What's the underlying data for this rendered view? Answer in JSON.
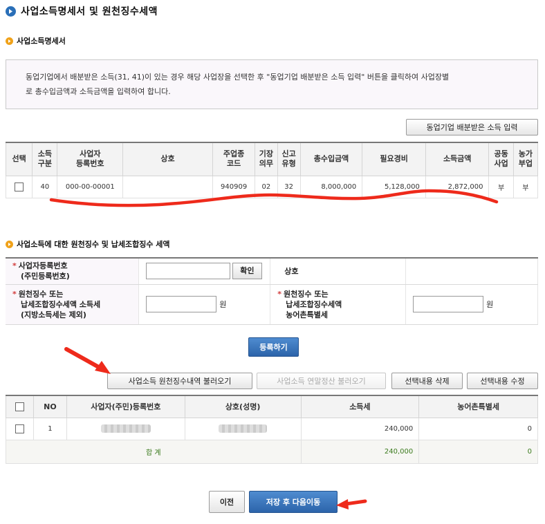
{
  "page": {
    "title": "사업소득명세서 및 원천징수세액"
  },
  "section1": {
    "title": "사업소득명세서",
    "notice_line1": "동업기업에서 배분받은 소득(31, 41)이 있는 경우 해당 사업장을 선택한 후 \"동업기업 배분받은 소득 입력\" 버튼을 클릭하여 사업장별",
    "notice_line2": "로 총수입금액과 소득금액을 입력하여 합니다.",
    "input_button": "동업기업 배분받은 소득 입력",
    "headers": {
      "select": "선택",
      "income_type_1": "소득",
      "income_type_2": "구분",
      "bizno_1": "사업자",
      "bizno_2": "등록번호",
      "name": "상호",
      "industry_1": "주업종",
      "industry_2": "코드",
      "bookkeep_1": "기장",
      "bookkeep_2": "의무",
      "report_1": "신고",
      "report_2": "유형",
      "revenue": "총수입금액",
      "expense": "필요경비",
      "income": "소득금액",
      "joint_1": "공동",
      "joint_2": "사업",
      "farm_1": "농가",
      "farm_2": "부업"
    },
    "row": {
      "income_type": "40",
      "bizno": "000-00-00001",
      "name": "",
      "industry": "940909",
      "bookkeep": "02",
      "report": "32",
      "revenue": "8,000,000",
      "expense": "5,128,000",
      "income": "2,872,000",
      "joint": "부",
      "farm": "부"
    }
  },
  "section2": {
    "title": "사업소득에 대한 원천징수 및 납세조합징수 세액",
    "bizno_label_1": "사업자등록번호",
    "bizno_label_2": "(주민등록번호)",
    "confirm_button": "확인",
    "name_label": "상호",
    "tax_label_1": "원천징수 또는",
    "tax_label_2": "납세조합징수세액 소득세",
    "tax_label_3": "(지방소득세는 제외)",
    "tax_unit": "원",
    "rural_label_1": "원천징수 또는",
    "rural_label_2": "납세조합징수세액",
    "rural_label_3": "농어촌특별세",
    "rural_unit": "원",
    "register_button": "등록하기"
  },
  "actions": {
    "load_withholding": "사업소득 원천징수내역 불러오기",
    "load_yearend": "사업소득 연말정산 불러오기",
    "delete_selected": "선택내용 삭제",
    "edit_selected": "선택내용 수정"
  },
  "grid2": {
    "headers": {
      "no": "NO",
      "bizno": "사업자(주민)등록번호",
      "name": "상호(성명)",
      "income_tax": "소득세",
      "rural_tax": "농어촌특별세"
    },
    "row": {
      "no": "1",
      "income_tax": "240,000",
      "rural_tax": "0"
    },
    "total": {
      "label": "합 계",
      "income_tax": "240,000",
      "rural_tax": "0"
    }
  },
  "footer": {
    "prev_button": "이전",
    "save_next_button": "저장 후 다음이동"
  },
  "colors": {
    "title_icon": "#2a6fb8",
    "section_icon": "#f0a21a",
    "primary_button": "#2c64aa",
    "annotation": "#ee2a1b",
    "total_text": "#3a7a1c"
  }
}
